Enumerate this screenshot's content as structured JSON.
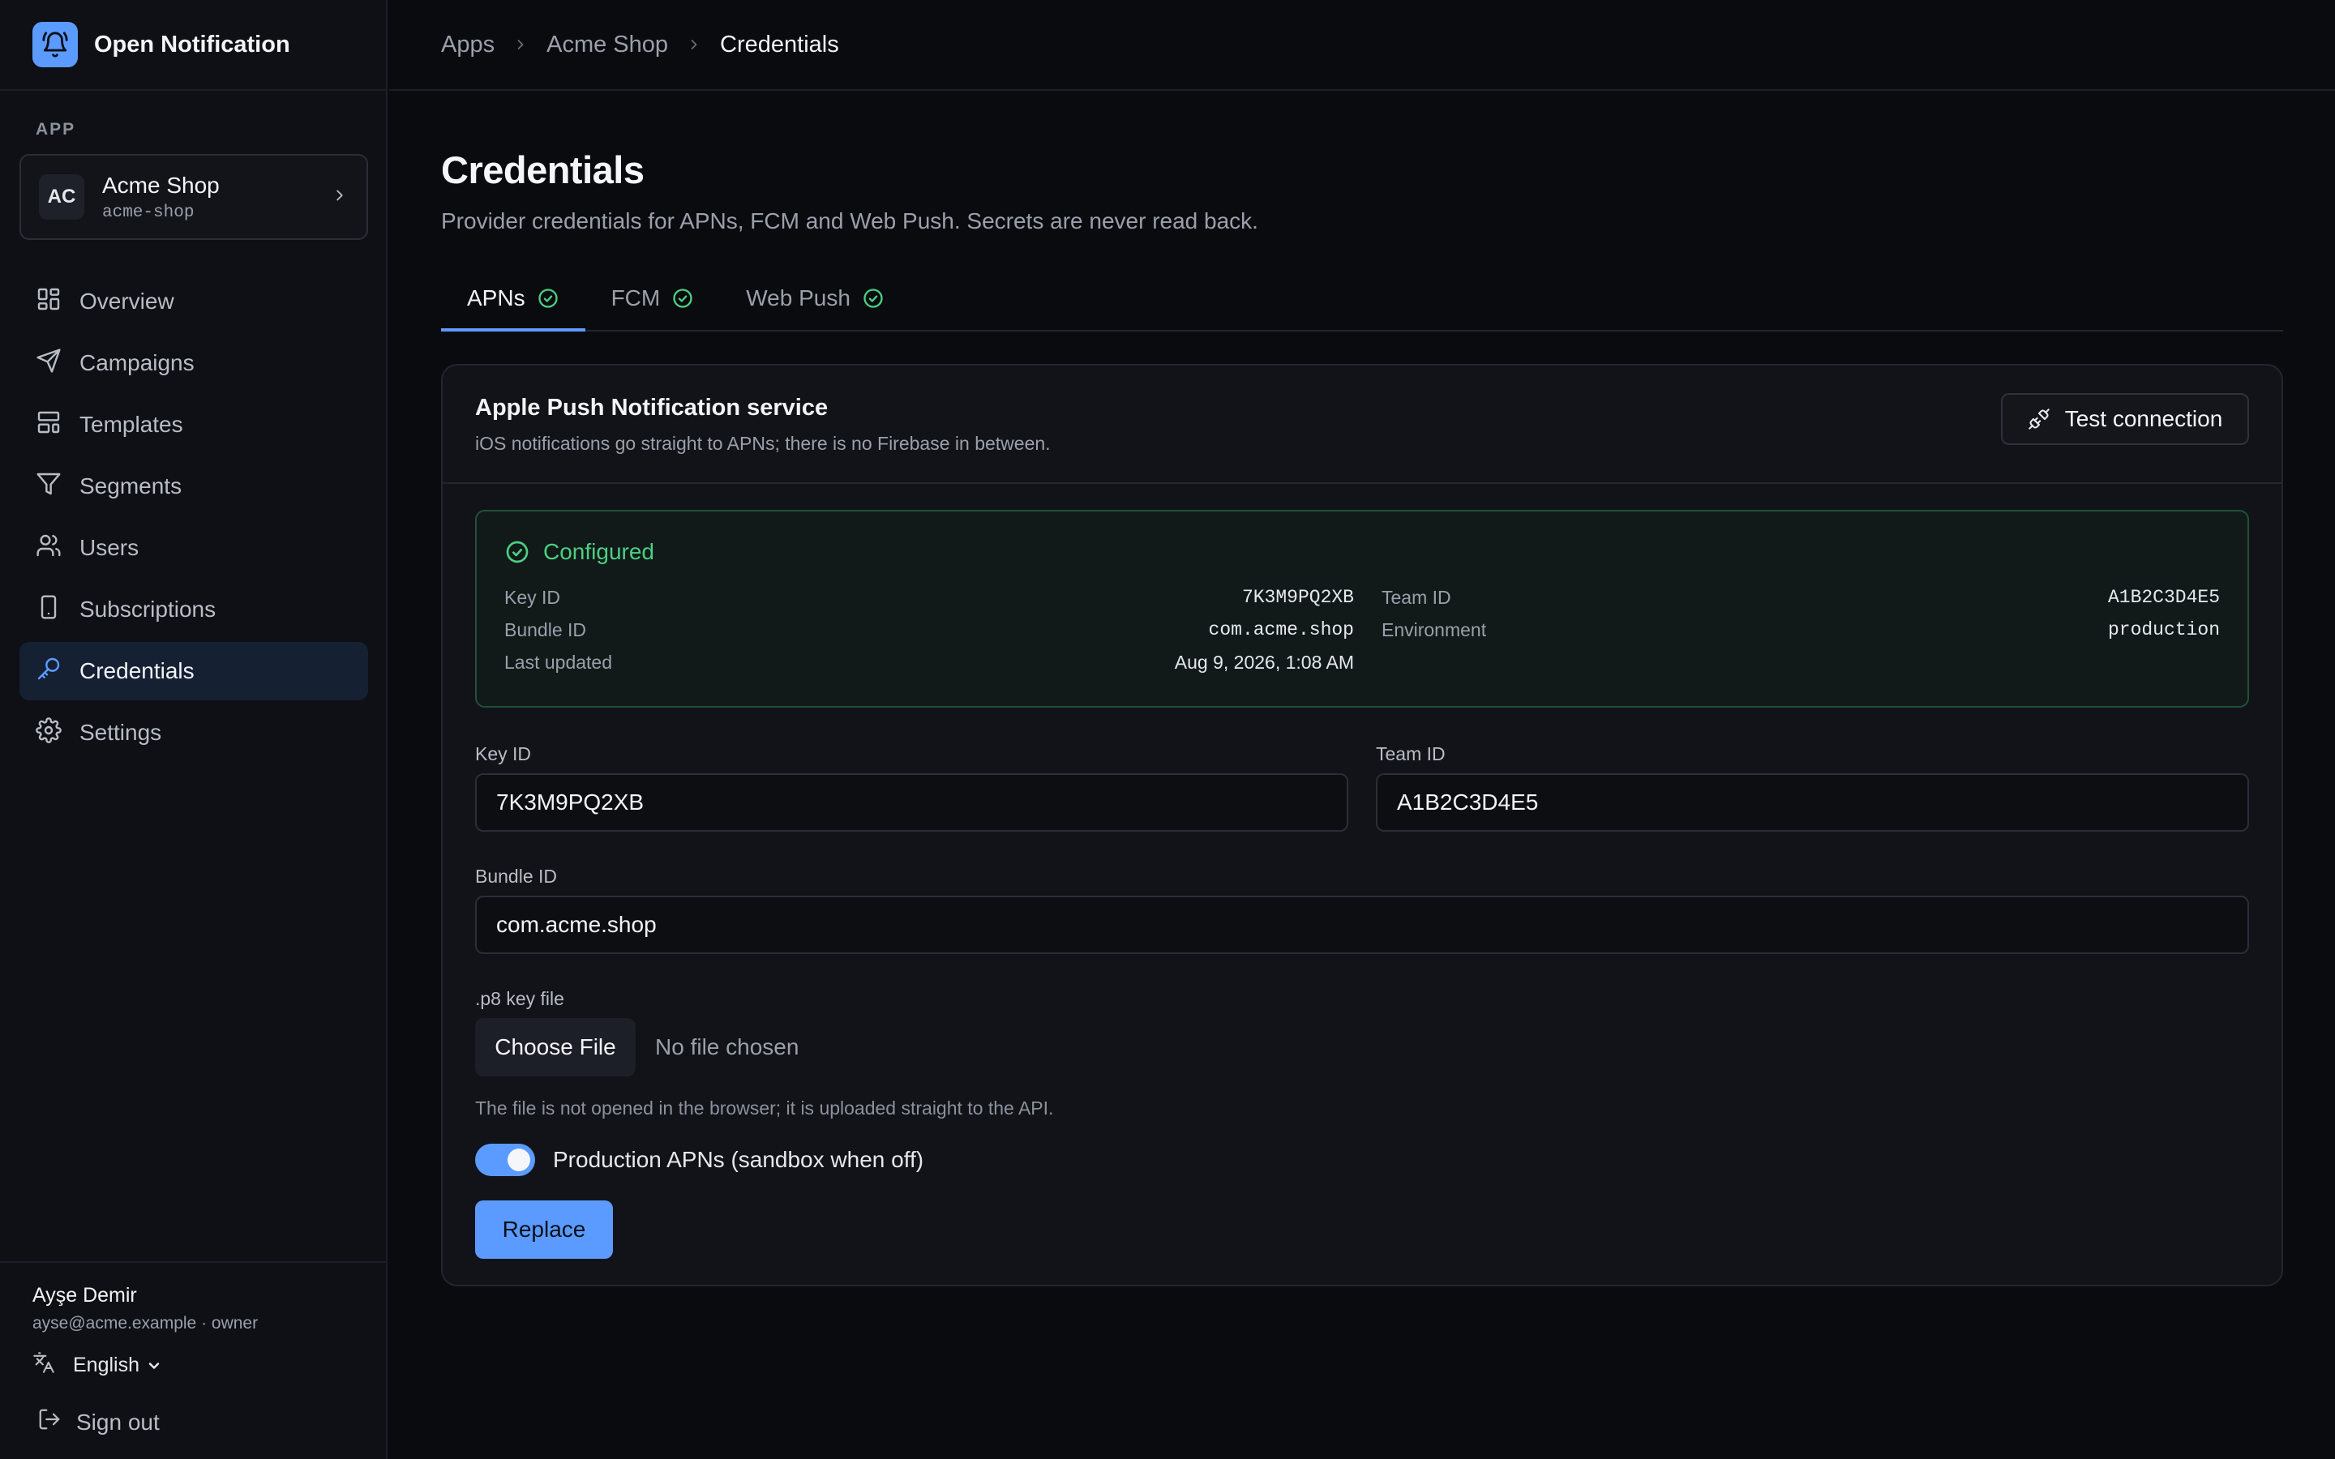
{
  "brand": {
    "name": "Open Notification",
    "icon": "bell-icon",
    "color": "#5b9bff"
  },
  "sidebar": {
    "section_label": "APP",
    "app": {
      "initials": "AC",
      "name": "Acme Shop",
      "slug": "acme-shop"
    },
    "items": [
      {
        "label": "Overview",
        "icon": "dashboard-icon"
      },
      {
        "label": "Campaigns",
        "icon": "send-icon"
      },
      {
        "label": "Templates",
        "icon": "layout-icon"
      },
      {
        "label": "Segments",
        "icon": "filter-icon"
      },
      {
        "label": "Users",
        "icon": "users-icon"
      },
      {
        "label": "Subscriptions",
        "icon": "phone-icon"
      },
      {
        "label": "Credentials",
        "icon": "key-icon",
        "active": true
      },
      {
        "label": "Settings",
        "icon": "gear-icon"
      }
    ],
    "footer": {
      "user_name": "Ayşe Demir",
      "user_meta": "ayse@acme.example · owner",
      "language": "English",
      "sign_out": "Sign out"
    }
  },
  "breadcrumb": [
    "Apps",
    "Acme Shop",
    "Credentials"
  ],
  "page": {
    "title": "Credentials",
    "subtitle": "Provider credentials for APNs, FCM and Web Push. Secrets are never read back."
  },
  "tabs": [
    {
      "label": "APNs",
      "active": true,
      "status": "configured"
    },
    {
      "label": "FCM",
      "active": false,
      "status": "configured"
    },
    {
      "label": "Web Push",
      "active": false,
      "status": "configured"
    }
  ],
  "card": {
    "title": "Apple Push Notification service",
    "description": "iOS notifications go straight to APNs; there is no Firebase in between.",
    "test_button": "Test connection",
    "status": {
      "label": "Configured",
      "left": [
        {
          "key": "Key ID",
          "value": "7K3M9PQ2XB",
          "mono": true
        },
        {
          "key": "Bundle ID",
          "value": "com.acme.shop",
          "mono": true
        },
        {
          "key": "Last updated",
          "value": "Aug 9, 2026, 1:08 AM",
          "mono": false
        }
      ],
      "right": [
        {
          "key": "Team ID",
          "value": "A1B2C3D4E5",
          "mono": true
        },
        {
          "key": "Environment",
          "value": "production",
          "mono": true
        }
      ]
    },
    "form": {
      "key_id": {
        "label": "Key ID",
        "value": "7K3M9PQ2XB"
      },
      "team_id": {
        "label": "Team ID",
        "value": "A1B2C3D4E5"
      },
      "bundle_id": {
        "label": "Bundle ID",
        "value": "com.acme.shop"
      },
      "p8": {
        "label": ".p8 key file",
        "button": "Choose File",
        "status": "No file chosen"
      },
      "hint": "The file is not opened in the browser; it is uploaded straight to the API.",
      "toggle": {
        "label": "Production APNs (sandbox when off)",
        "on": true
      },
      "submit": "Replace"
    }
  },
  "colors": {
    "accent": "#5b9bff",
    "success": "#4ccf82",
    "background": "#0a0b0f"
  }
}
